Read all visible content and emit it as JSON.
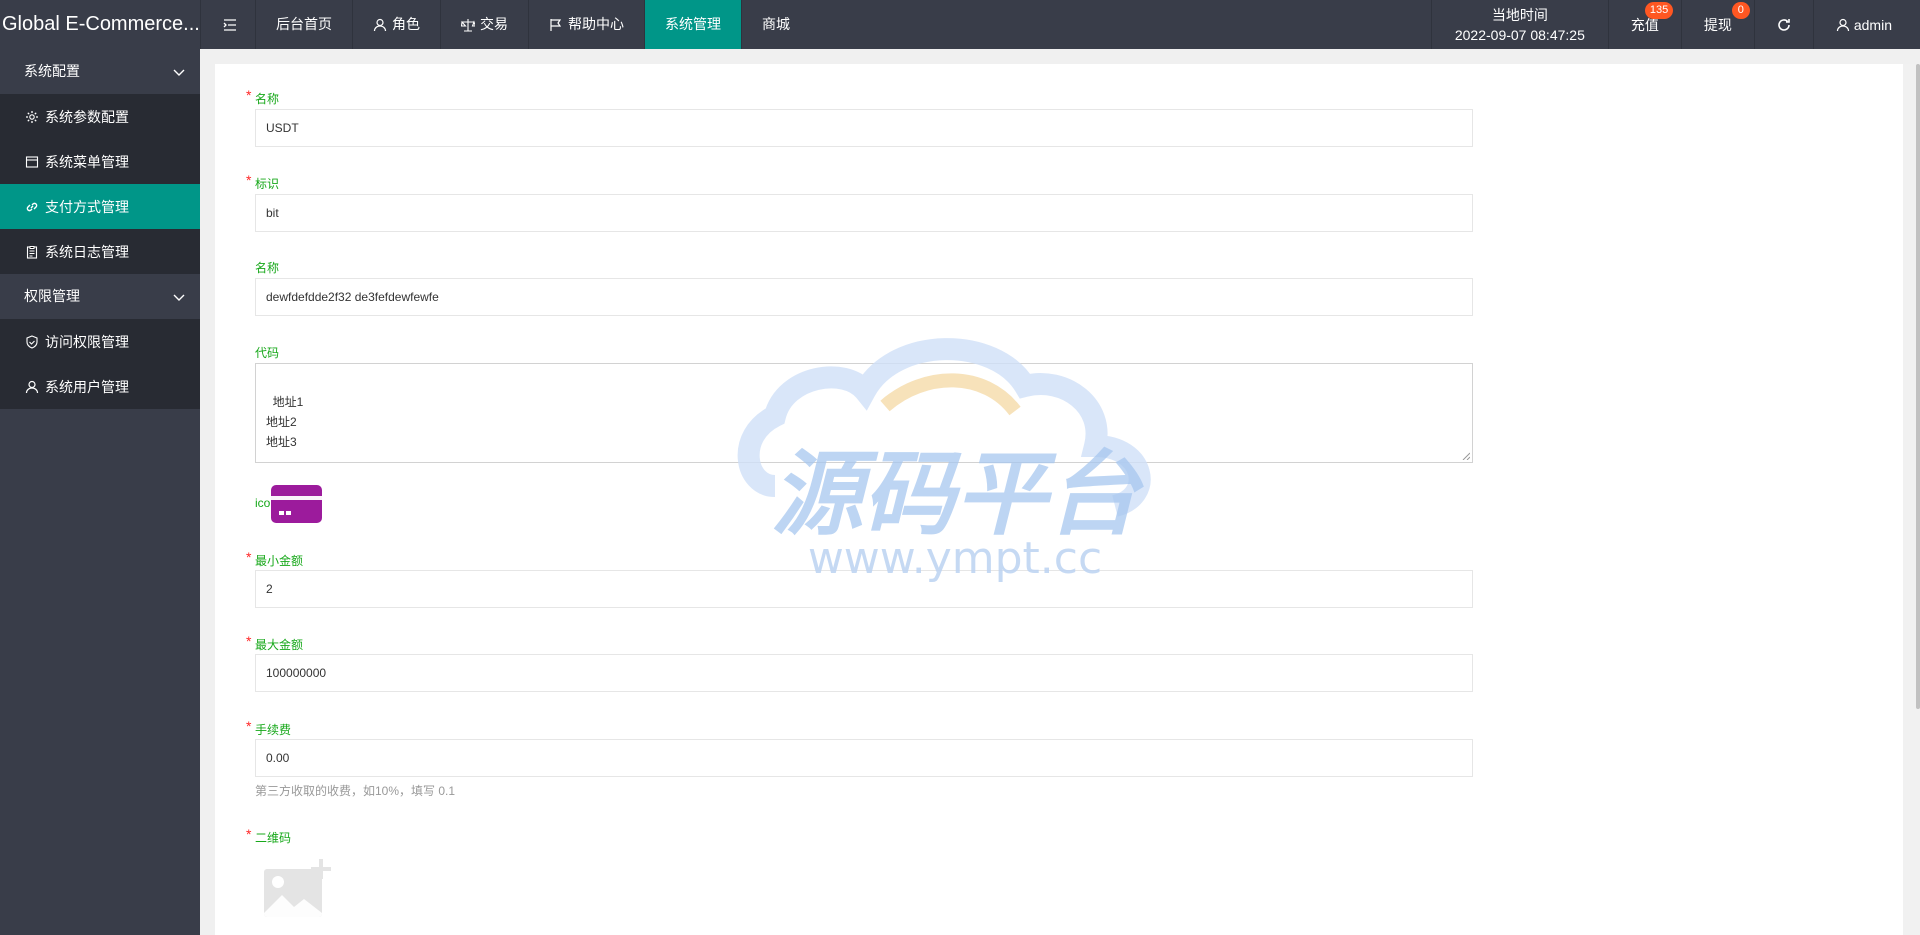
{
  "app": {
    "title": "Global E-Commerce..."
  },
  "nav": {
    "items": [
      {
        "label": "后台首页"
      },
      {
        "label": "角色"
      },
      {
        "label": "交易"
      },
      {
        "label": "帮助中心"
      },
      {
        "label": "系统管理"
      },
      {
        "label": "商城"
      }
    ]
  },
  "header": {
    "time_label": "当地时间",
    "time_value": "2022-09-07 08:47:25",
    "recharge_label": "充值",
    "recharge_badge": "135",
    "withdraw_label": "提现",
    "withdraw_badge": "0",
    "user": "admin"
  },
  "sidebar": {
    "groups": [
      {
        "label": "系统配置",
        "items": [
          {
            "label": "系统参数配置"
          },
          {
            "label": "系统菜单管理"
          },
          {
            "label": "支付方式管理"
          },
          {
            "label": "系统日志管理"
          }
        ]
      },
      {
        "label": "权限管理",
        "items": [
          {
            "label": "访问权限管理"
          },
          {
            "label": "系统用户管理"
          }
        ]
      }
    ]
  },
  "form": {
    "name_label": "名称",
    "name_value": "USDT",
    "code_label": "标识",
    "code_value": "bit",
    "name2_label": "名称",
    "name2_value": "dewfdefdde2f32 de3fefdewfewfe",
    "address_label": "代码",
    "address_value": "地址1\n地址2\n地址3",
    "icon_label": "ico",
    "min_label": "最小金额",
    "min_value": "2",
    "max_label": "最大金额",
    "max_value": "100000000",
    "fee_label": "手续费",
    "fee_value": "0.00",
    "fee_hint": "第三方收取的收费，如10%，填写 0.1",
    "qrcode_label": "二维码"
  },
  "watermark": {
    "title": "源码平台",
    "url": "www.ympt.cc"
  },
  "colors": {
    "header_bg": "#393d49",
    "accent": "#009688",
    "label_green": "#17a81a",
    "required_red": "#ff2626",
    "badge": "#ff5722",
    "icon_purple": "#9c1b9c"
  }
}
